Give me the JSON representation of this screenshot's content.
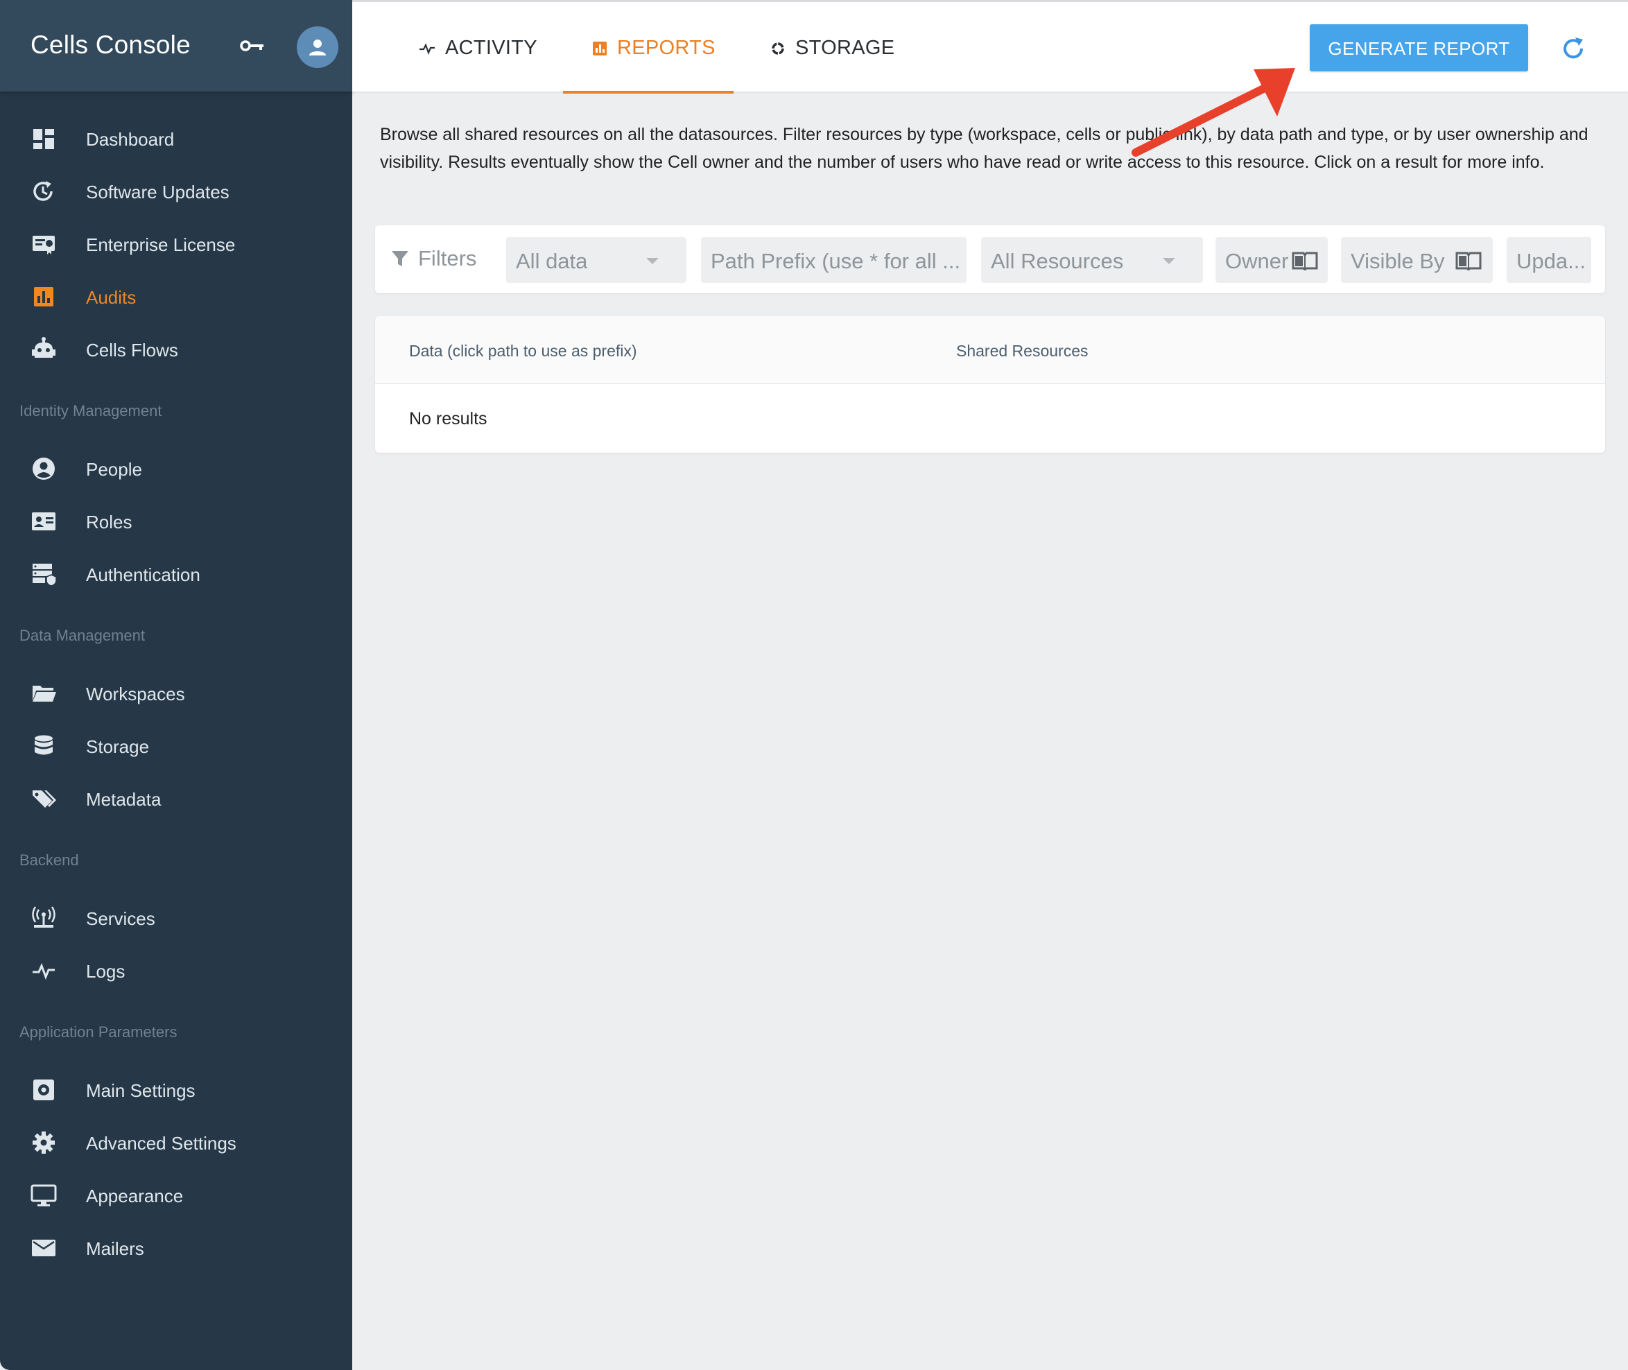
{
  "app": {
    "title": "Cells Console"
  },
  "sidebar": {
    "items": [
      {
        "label": "Dashboard",
        "icon": "dashboard-icon"
      },
      {
        "label": "Software Updates",
        "icon": "update-icon"
      },
      {
        "label": "Enterprise License",
        "icon": "license-icon"
      },
      {
        "label": "Audits",
        "icon": "chart-icon",
        "active": true
      },
      {
        "label": "Cells Flows",
        "icon": "robot-icon"
      }
    ],
    "sections": [
      {
        "title": "Identity Management",
        "items": [
          {
            "label": "People",
            "icon": "user-icon"
          },
          {
            "label": "Roles",
            "icon": "id-card-icon"
          },
          {
            "label": "Authentication",
            "icon": "auth-server-icon"
          }
        ]
      },
      {
        "title": "Data Management",
        "items": [
          {
            "label": "Workspaces",
            "icon": "folder-icon"
          },
          {
            "label": "Storage",
            "icon": "database-icon"
          },
          {
            "label": "Metadata",
            "icon": "tags-icon"
          }
        ]
      },
      {
        "title": "Backend",
        "items": [
          {
            "label": "Services",
            "icon": "antenna-icon"
          },
          {
            "label": "Logs",
            "icon": "pulse-icon"
          }
        ]
      },
      {
        "title": "Application Parameters",
        "items": [
          {
            "label": "Main Settings",
            "icon": "settings-box-icon"
          },
          {
            "label": "Advanced Settings",
            "icon": "gear-icon"
          },
          {
            "label": "Appearance",
            "icon": "monitor-icon"
          },
          {
            "label": "Mailers",
            "icon": "mail-icon"
          }
        ]
      }
    ]
  },
  "tabs": [
    {
      "label": "ACTIVITY",
      "icon": "pulse-icon"
    },
    {
      "label": "REPORTS",
      "icon": "chart-icon",
      "active": true
    },
    {
      "label": "STORAGE",
      "icon": "ring-icon"
    }
  ],
  "toolbar": {
    "generate_label": "GENERATE REPORT"
  },
  "description": "Browse all shared resources on all the datasources. Filter resources by type (workspace, cells or public link), by data path and type, or by user ownership and visibility. Results eventually show the Cell owner and the number of users who have read or write access to this resource. Click on a result for more info.",
  "filters": {
    "title": "Filters",
    "data_select": "All data",
    "path_placeholder": "Path Prefix (use * for all ...",
    "resources_select": "All Resources",
    "owner": "Owner",
    "visible_by": "Visible By",
    "updated": "Upda..."
  },
  "table": {
    "columns": [
      "Data (click path to use as prefix)",
      "Shared Resources"
    ],
    "empty_text": "No results"
  },
  "colors": {
    "sidebar_bg": "#263847",
    "sidebar_header_bg": "#334a5c",
    "accent": "#ee7f22",
    "primary_button": "#45a4ea",
    "annotation_arrow": "#e8402a"
  }
}
